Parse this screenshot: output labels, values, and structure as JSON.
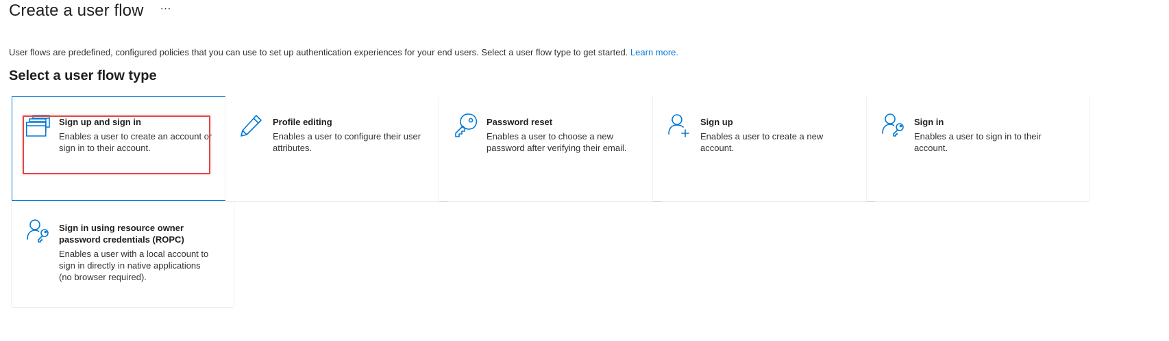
{
  "header": {
    "title": "Create a user flow",
    "more_label": "···"
  },
  "intro": {
    "text": "User flows are predefined, configured policies that you can use to set up authentication experiences for your end users. Select a user flow type to get started.",
    "learn_more": "Learn more."
  },
  "section": {
    "heading": "Select a user flow type"
  },
  "cards": [
    {
      "title": "Sign up and sign in",
      "description": "Enables a user to create an account or sign in to their account.",
      "icon": "windows-stack-icon",
      "selected": true
    },
    {
      "title": "Profile editing",
      "description": "Enables a user to configure their user attributes.",
      "icon": "pencil-icon",
      "selected": false
    },
    {
      "title": "Password reset",
      "description": "Enables a user to choose a new password after verifying their email.",
      "icon": "key-icon",
      "selected": false
    },
    {
      "title": "Sign up",
      "description": "Enables a user to create a new account.",
      "icon": "user-add-icon",
      "selected": false
    },
    {
      "title": "Sign in",
      "description": "Enables a user to sign in to their account.",
      "icon": "user-key-icon",
      "selected": false
    },
    {
      "title": "Sign in using resource owner password credentials (ROPC)",
      "description": "Enables a user with a local account to sign in directly in native applications (no browser required).",
      "icon": "user-key-icon",
      "selected": false
    }
  ],
  "colors": {
    "accent": "#0078d4",
    "highlight": "#e04848"
  }
}
